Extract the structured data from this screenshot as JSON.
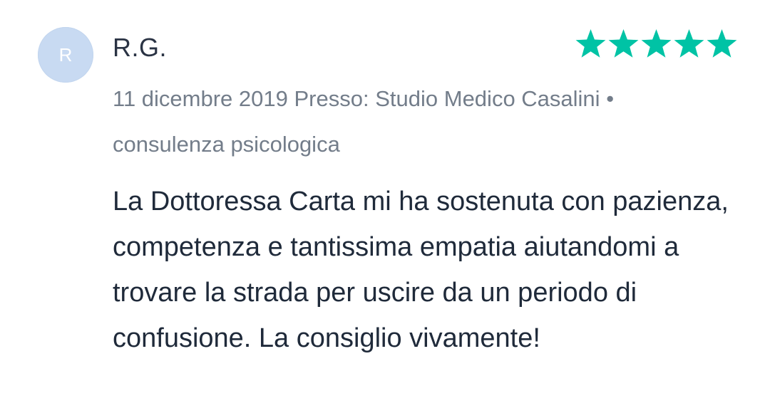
{
  "review": {
    "avatar_initial": "R",
    "author": "R.G.",
    "rating": 5,
    "rating_max": 5,
    "star_color": "#00c3a5",
    "star_icon": "star-icon",
    "date": "11 dicembre 2019",
    "location_label": "Presso:",
    "location": "Studio Medico Casalini",
    "separator": "•",
    "service": "consulenza psicologica",
    "text": "La Dottoressa Carta mi ha sostenuta con pazienza, competenza e tantissima empatia aiutandomi a trovare la strada per uscire da un periodo di confusione. La consiglio vivamente!"
  }
}
